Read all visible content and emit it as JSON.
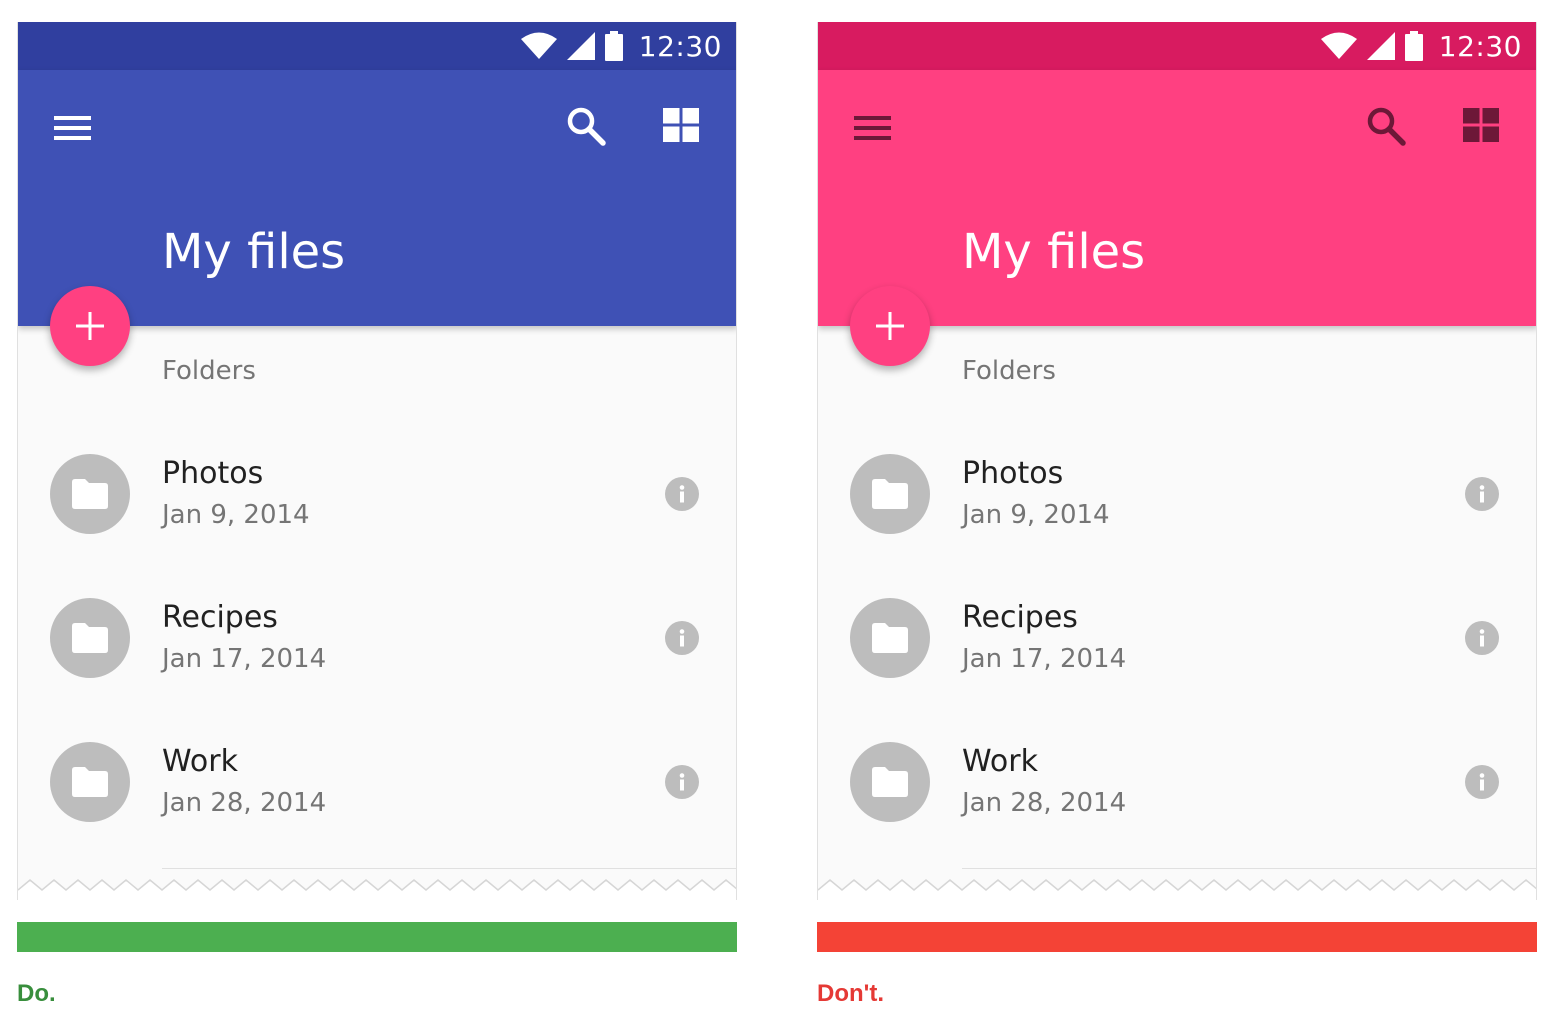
{
  "panels": {
    "do": {
      "status": {
        "time": "12:30"
      },
      "colors": {
        "status_bar": "#303f9f",
        "app_bar": "#3f51b5",
        "action_icons": "#ffffff",
        "verdict_bar": "#4caf50",
        "caption": "#388e3c"
      },
      "app_bar": {
        "title": "My files",
        "nav_icon": "menu-icon",
        "actions": [
          "search-icon",
          "grid-view-icon"
        ]
      },
      "fab": {
        "icon": "add-icon",
        "color": "#ff4081"
      },
      "section_label": "Folders",
      "folders": [
        {
          "name": "Photos",
          "date": "Jan 9, 2014"
        },
        {
          "name": "Recipes",
          "date": "Jan 17, 2014"
        },
        {
          "name": "Work",
          "date": "Jan 28, 2014"
        }
      ],
      "caption": "Do."
    },
    "dont": {
      "status": {
        "time": "12:30"
      },
      "colors": {
        "status_bar": "#d81b60",
        "app_bar": "#ff4081",
        "action_icons": "#6d1838",
        "verdict_bar": "#f44336",
        "caption": "#e53935"
      },
      "app_bar": {
        "title": "My files",
        "nav_icon": "menu-icon",
        "actions": [
          "search-icon",
          "grid-view-icon"
        ]
      },
      "fab": {
        "icon": "add-icon",
        "color": "#ff4081"
      },
      "section_label": "Folders",
      "folders": [
        {
          "name": "Photos",
          "date": "Jan 9, 2014"
        },
        {
          "name": "Recipes",
          "date": "Jan 17, 2014"
        },
        {
          "name": "Work",
          "date": "Jan 28, 2014"
        }
      ],
      "caption": "Don't."
    }
  }
}
